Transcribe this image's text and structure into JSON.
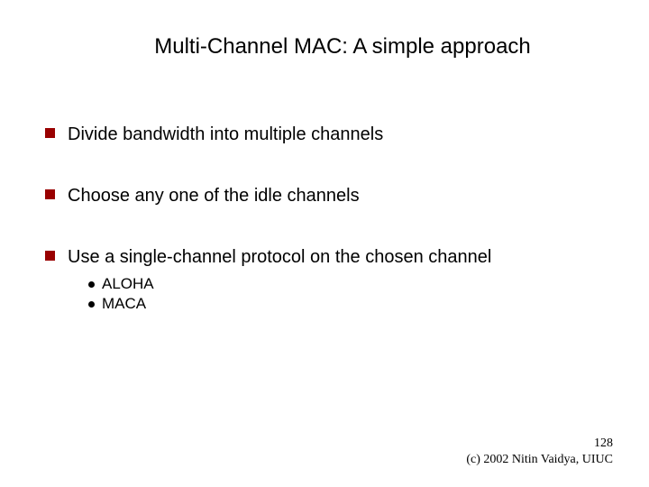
{
  "title": "Multi-Channel MAC: A simple approach",
  "bullets": {
    "b1": "Divide bandwidth into multiple channels",
    "b2": "Choose any one of the idle channels",
    "b3": "Use a single-channel protocol on the chosen channel",
    "sub1": "ALOHA",
    "sub2": "MACA"
  },
  "footer": {
    "page": "128",
    "copyright": "(c) 2002 Nitin Vaidya, UIUC"
  }
}
